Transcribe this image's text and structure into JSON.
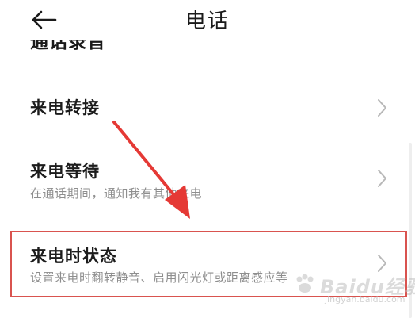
{
  "header": {
    "title": "电话",
    "back_icon": "arrow-left-icon"
  },
  "clipped_row": {
    "label": "通话录音"
  },
  "settings": [
    {
      "title": "来电转接",
      "subtitle": ""
    },
    {
      "title": "来电等待",
      "subtitle": "在通话期间，通知我有其他来电"
    },
    {
      "title": "来电时状态",
      "subtitle": "设置来电时翻转静音、启用闪光灯或距离感应等"
    }
  ],
  "annotation": {
    "box_color": "#d9534f",
    "arrow_color": "#e53935"
  },
  "watermark": {
    "brand": "Baidu经验",
    "sub": "jingyan.baidu.com"
  }
}
